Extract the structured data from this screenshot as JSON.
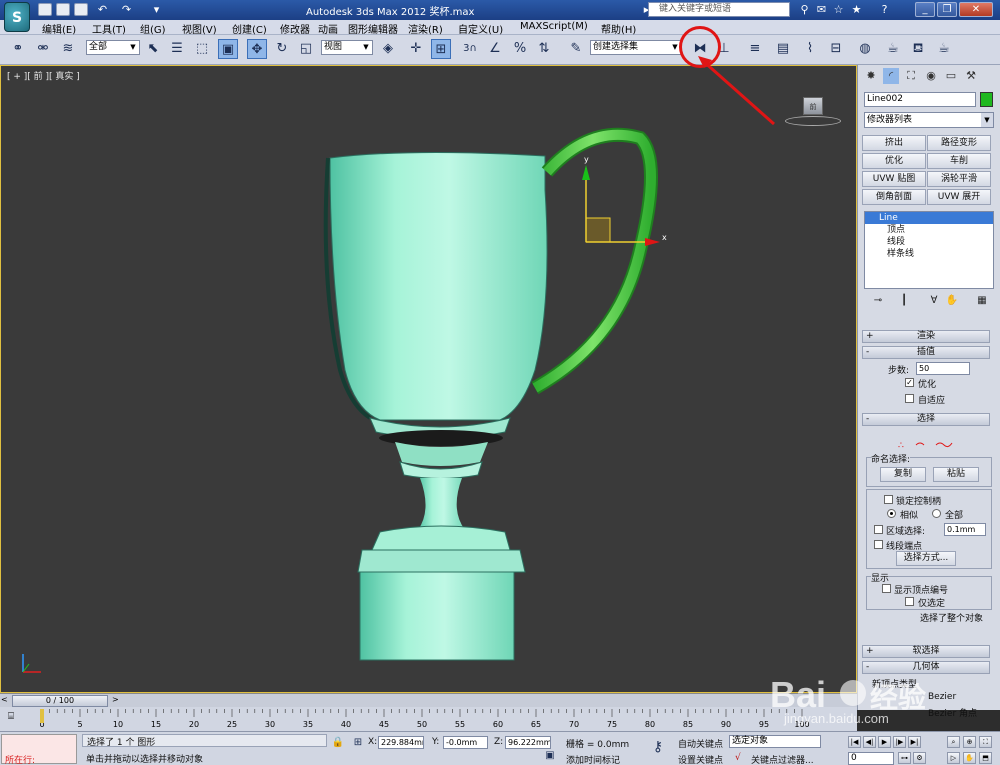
{
  "titlebar": {
    "title": "Autodesk 3ds Max  2012     奖杯.max",
    "search_placeholder": "键入关键字或短语",
    "logo_letter": "S"
  },
  "menu": {
    "items": [
      "编辑(E)",
      "工具(T)",
      "组(G)",
      "视图(V)",
      "创建(C)",
      "修改器",
      "动画",
      "图形编辑器",
      "渲染(R)",
      "自定义(U)",
      "MAXScript(M)",
      "帮助(H)"
    ]
  },
  "toolbar": {
    "selection_filter": "全部",
    "ref_coord": "视图",
    "named_selection": "创建选择集",
    "snap_label": "3"
  },
  "viewport": {
    "label": "[ + ][ 前 ][ 真实 ]",
    "viewcube_label": "前",
    "gizmo_x": "x",
    "gizmo_y": "y"
  },
  "command_panel": {
    "object_name": "Line002",
    "object_color": "#1fb81f",
    "modifier_list": "修改器列表",
    "modifier_buttons": [
      [
        "挤出",
        "路径变形"
      ],
      [
        "优化",
        "车削"
      ],
      [
        "UVW 贴图",
        "涡轮平滑"
      ],
      [
        "倒角剖面",
        "UVW 展开"
      ]
    ],
    "stack": [
      "Line",
      "顶点",
      "线段",
      "样条线"
    ],
    "rollouts": {
      "render": "渲染",
      "interp": "插值",
      "steps_label": "步数:",
      "steps_value": "50",
      "optimize": "优化",
      "adaptive": "自适应",
      "selection": "选择",
      "named_sel": "命名选择:",
      "copy": "复制",
      "paste": "粘贴",
      "lock_handles": "锁定控制柄",
      "similar": "相似",
      "all": "全部",
      "area_sel": "区域选择:",
      "area_val": "0.1mm",
      "seg_end": "线段端点",
      "sel_by": "选择方式...",
      "display": "显示",
      "show_vnum": "显示顶点编号",
      "only_sel": "仅选定",
      "selected_info": "选择了整个对象",
      "soft_sel": "软选择",
      "geometry": "几何体",
      "new_vertex_type": "新顶点类型",
      "bezier": "Bezier",
      "bezier_corner": "Bezier 角点"
    }
  },
  "timeline": {
    "slider": "0 / 100",
    "ticks": [
      "0",
      "5",
      "10",
      "15",
      "20",
      "25",
      "30",
      "35",
      "40",
      "45",
      "50",
      "55",
      "60",
      "65",
      "70",
      "75",
      "80",
      "85",
      "90",
      "95",
      "100"
    ]
  },
  "status": {
    "maxscript": "所在行:",
    "line1": "选择了 1 个 图形",
    "line2": "单击并拖动以选择并移动对象",
    "x_label": "X:",
    "x_val": "229.884mm",
    "y_label": "Y:",
    "y_val": "-0.0mm",
    "z_label": "Z:",
    "z_val": "96.222mm",
    "grid": "栅格 = 0.0mm",
    "auto_key": "自动关键点",
    "set_key": "设置关键点",
    "key_mode": "选定对象",
    "add_time_tag": "添加时间标记",
    "key_filters": "关键点过滤器...",
    "frame": "0"
  },
  "watermark": {
    "brand": "Bai",
    "brand2": "经验",
    "url": "jingyan.baidu.com"
  }
}
